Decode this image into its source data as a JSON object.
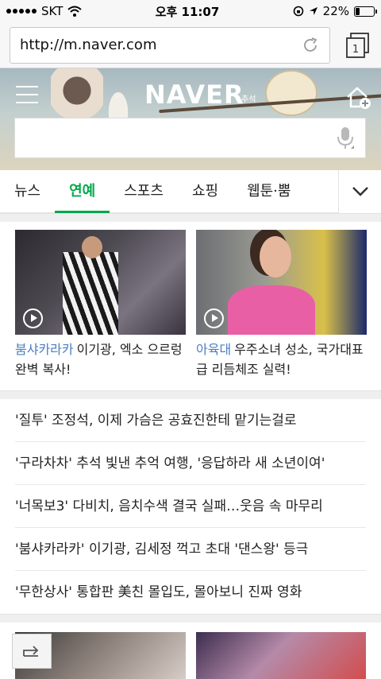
{
  "status_bar": {
    "carrier": "SKT",
    "time": "오후 11:07",
    "battery": "22%",
    "battery_level": 0.22
  },
  "browser": {
    "url": "http://m.naver.com",
    "tab_count": "1"
  },
  "header": {
    "logo": "NAVER",
    "logo_sub": "추석"
  },
  "tabs": [
    {
      "label": "뉴스",
      "active": false
    },
    {
      "label": "연예",
      "active": true
    },
    {
      "label": "스포츠",
      "active": false
    },
    {
      "label": "쇼핑",
      "active": false
    },
    {
      "label": "웹툰·뿜",
      "active": false
    }
  ],
  "cards": [
    {
      "tag": "붐샤카라카",
      "text": "이기광, 엑소 으르렁 완벽 복사!"
    },
    {
      "tag": "아육대",
      "text": "우주소녀 성소, 국가대표급 리듬체조 실력!"
    }
  ],
  "headlines": [
    "'질투' 조정석, 이제 가슴은 공효진한테 맡기는걸로",
    "'구라차차' 추석 빛낸 추억 여행, '응답하라 새 소년이여'",
    "'너목보3' 다비치, 음치수색 결국 실패…웃음 속 마무리",
    "'붐샤카라카' 이기광, 김세정 꺽고 초대 '댄스왕' 등극",
    "'무한상사' 통합판 美친 몰입도, 몰아보니 진짜 영화"
  ],
  "colors": {
    "accent": "#03a94c",
    "tag": "#4a7fc1"
  }
}
